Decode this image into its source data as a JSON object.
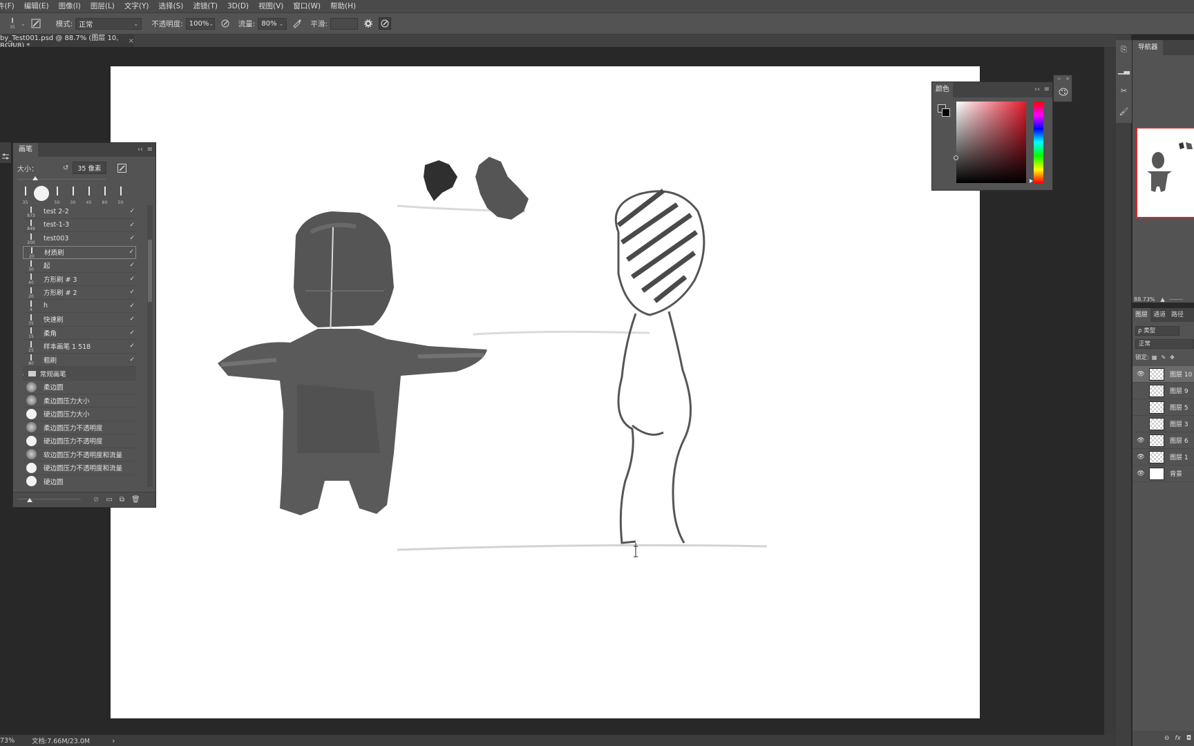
{
  "menu": [
    "件(F)",
    "编辑(E)",
    "图像(I)",
    "图层(L)",
    "文字(Y)",
    "选择(S)",
    "滤镜(T)",
    "3D(D)",
    "视图(V)",
    "窗口(W)",
    "帮助(H)"
  ],
  "options": {
    "brush_size_num": "35",
    "mode_label": "模式:",
    "mode_value": "正常",
    "opacity_label": "不透明度:",
    "opacity_value": "100%",
    "flow_label": "流量:",
    "flow_value": "80%",
    "smooth_label": "平滑:",
    "smooth_value": ""
  },
  "document": {
    "tab_title": "by_Test001.psd @ 88.7% (图层 10, RGB/8) *",
    "tab_close": "×"
  },
  "status": {
    "zoom": "73%",
    "doc_info": "文档:7.66M/23.0M",
    "arrow": "›"
  },
  "brush_panel": {
    "title": "画笔",
    "collapse": "‹‹",
    "size_label": "大小：",
    "size_value": "35 像素",
    "tips": [
      "35",
      "",
      "50",
      "30",
      "45",
      "80",
      "50"
    ],
    "brushes": [
      {
        "size": "873",
        "name": "test 2-2"
      },
      {
        "size": "849",
        "name": "test-1-3"
      },
      {
        "size": "200",
        "name": "test003"
      },
      {
        "size": "20",
        "name": "材质刷"
      },
      {
        "size": "30",
        "name": "起"
      },
      {
        "size": "40",
        "name": "方形刷 # 3"
      },
      {
        "size": "20",
        "name": "方形刷 # 2"
      },
      {
        "size": "4",
        "name": "h"
      },
      {
        "size": "35",
        "name": "快速刷"
      },
      {
        "size": "15",
        "name": "柔角"
      },
      {
        "size": "25",
        "name": "样本画笔 1 518"
      },
      {
        "size": "80",
        "name": "粗刷"
      }
    ],
    "group_name": "常规画笔",
    "round_brushes": [
      {
        "name": "柔边圆",
        "type": "soft"
      },
      {
        "name": "柔边圆压力大小",
        "type": "soft"
      },
      {
        "name": "硬边圆压力大小",
        "type": "hard"
      },
      {
        "name": "柔边圆压力不透明度",
        "type": "soft"
      },
      {
        "name": "硬边圆压力不透明度",
        "type": "hard"
      },
      {
        "name": "软边圆压力不透明度和流量",
        "type": "soft"
      },
      {
        "name": "硬边圆压力不透明度和流量",
        "type": "hard"
      },
      {
        "name": "硬边圆",
        "type": "hard"
      }
    ]
  },
  "color_panel": {
    "title": "颜色",
    "expand": "››",
    "fg_color": "#404040",
    "bg_color": "#000000"
  },
  "navigator": {
    "title": "导航器",
    "zoom": "88.73%"
  },
  "layers_panel": {
    "tabs": [
      "图层",
      "通道",
      "路径"
    ],
    "filter_label": "ρ 类型",
    "blend_mode": "正常",
    "lock_label": "锁定:",
    "layers": [
      {
        "name": "图层 10",
        "visible": true,
        "active": true,
        "thumb": "checker"
      },
      {
        "name": "图层 9",
        "visible": false,
        "active": false,
        "thumb": "checker"
      },
      {
        "name": "图层 5",
        "visible": false,
        "active": false,
        "thumb": "checker"
      },
      {
        "name": "图层 3",
        "visible": false,
        "active": false,
        "thumb": "checker"
      },
      {
        "name": "图层 6",
        "visible": true,
        "active": false,
        "thumb": "checker"
      },
      {
        "name": "图层 1",
        "visible": true,
        "active": false,
        "thumb": "checker"
      },
      {
        "name": "背景",
        "visible": true,
        "active": false,
        "thumb": "white"
      }
    ]
  }
}
